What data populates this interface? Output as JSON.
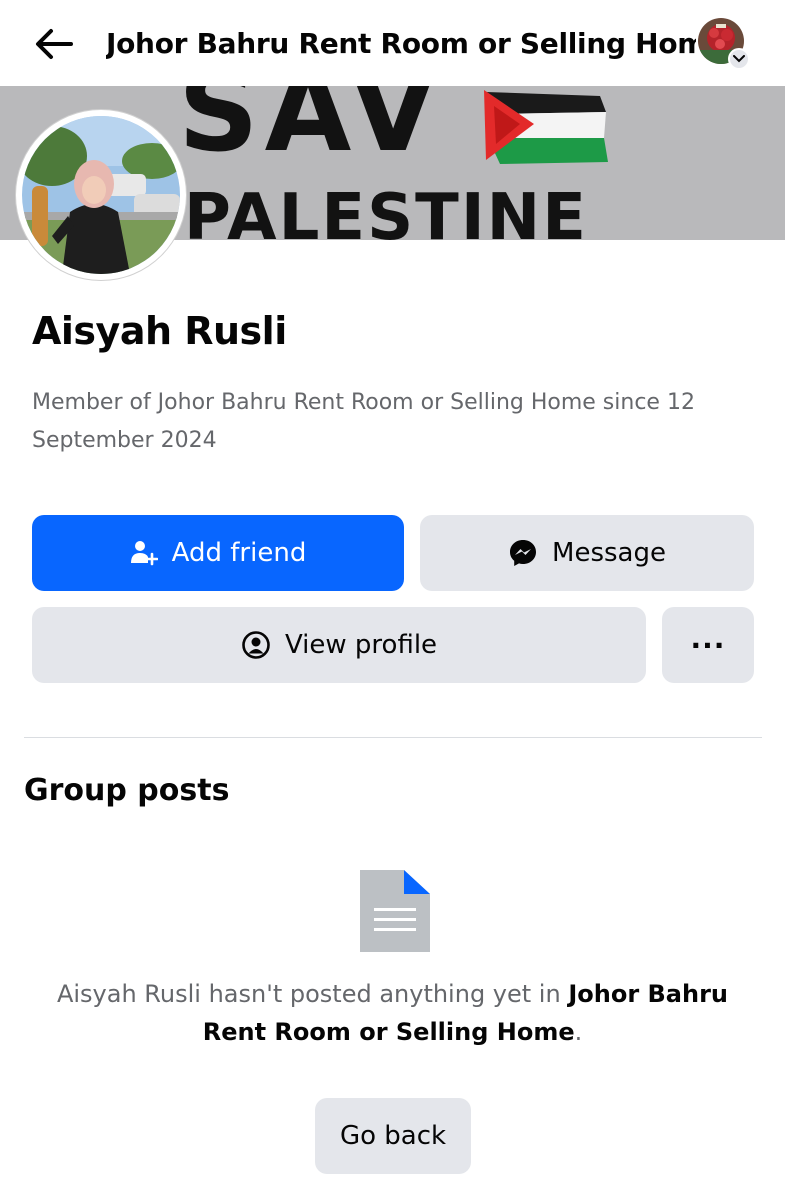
{
  "header": {
    "title": "Johor Bahru Rent Room or Selling Home",
    "back_icon": "arrow-left-icon",
    "account_icon": "account-avatar",
    "chevron_icon": "chevron-down-icon"
  },
  "cover": {
    "line1": "SAV",
    "line2": "PALESTINE"
  },
  "profile": {
    "name": "Aisyah Rusli",
    "member_text": "Member of Johor Bahru Rent Room or Selling Home since 12 September 2024"
  },
  "actions": {
    "add_friend": "Add friend",
    "message": "Message",
    "view_profile": "View profile",
    "more": "···"
  },
  "group_posts": {
    "title": "Group posts",
    "empty_prefix": "Aisyah Rusli hasn't posted anything yet in ",
    "group_name": "Johor Bahru Rent Room or Selling Home",
    "empty_suffix": ".",
    "go_back": "Go back"
  },
  "colors": {
    "primary": "#0866ff",
    "secondary_button": "#e4e6eb",
    "muted_text": "#65676b"
  }
}
